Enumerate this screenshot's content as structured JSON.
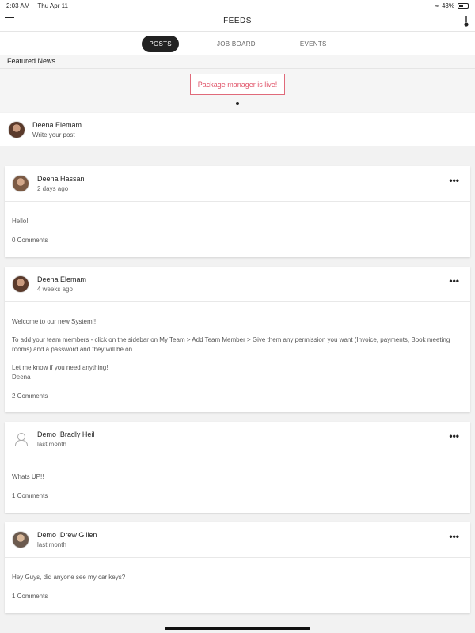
{
  "status": {
    "time": "2:03 AM",
    "date": "Thu Apr 11",
    "battery": "43%"
  },
  "navbar": {
    "title": "FEEDS"
  },
  "tabs": [
    {
      "label": "POSTS",
      "active": true
    },
    {
      "label": "JOB BOARD",
      "active": false
    },
    {
      "label": "EVENTS",
      "active": false
    }
  ],
  "featured": {
    "header": "Featured News",
    "items": [
      "Package manager is live!"
    ]
  },
  "composer": {
    "name": "Deena Elemam",
    "placeholder": "Write your post"
  },
  "posts": [
    {
      "author": "Deena Hassan",
      "time": "2 days ago",
      "paragraphs": [
        "Hello!"
      ],
      "comments": "0 Comments"
    },
    {
      "author": "Deena Elemam",
      "time": "4 weeks ago",
      "paragraphs": [
        "Welcome to our new System!!",
        "To add your team members - click on the sidebar on My Team > Add Team Member > Give them any permission you want (Invoice, payments, Book meeting rooms) and a password and they will be on.",
        "Let me know if you need anything!\nDeena"
      ],
      "comments": "2 Comments"
    },
    {
      "author": "Demo |Bradly Heil",
      "time": "last month",
      "paragraphs": [
        "Whats UP!!"
      ],
      "comments": "1 Comments"
    },
    {
      "author": "Demo |Drew Gillen",
      "time": "last month",
      "paragraphs": [
        "Hey Guys, did anyone see my car keys?"
      ],
      "comments": "1 Comments"
    }
  ],
  "colors": {
    "accent": "#e0556a",
    "active_tab": "#222222"
  }
}
